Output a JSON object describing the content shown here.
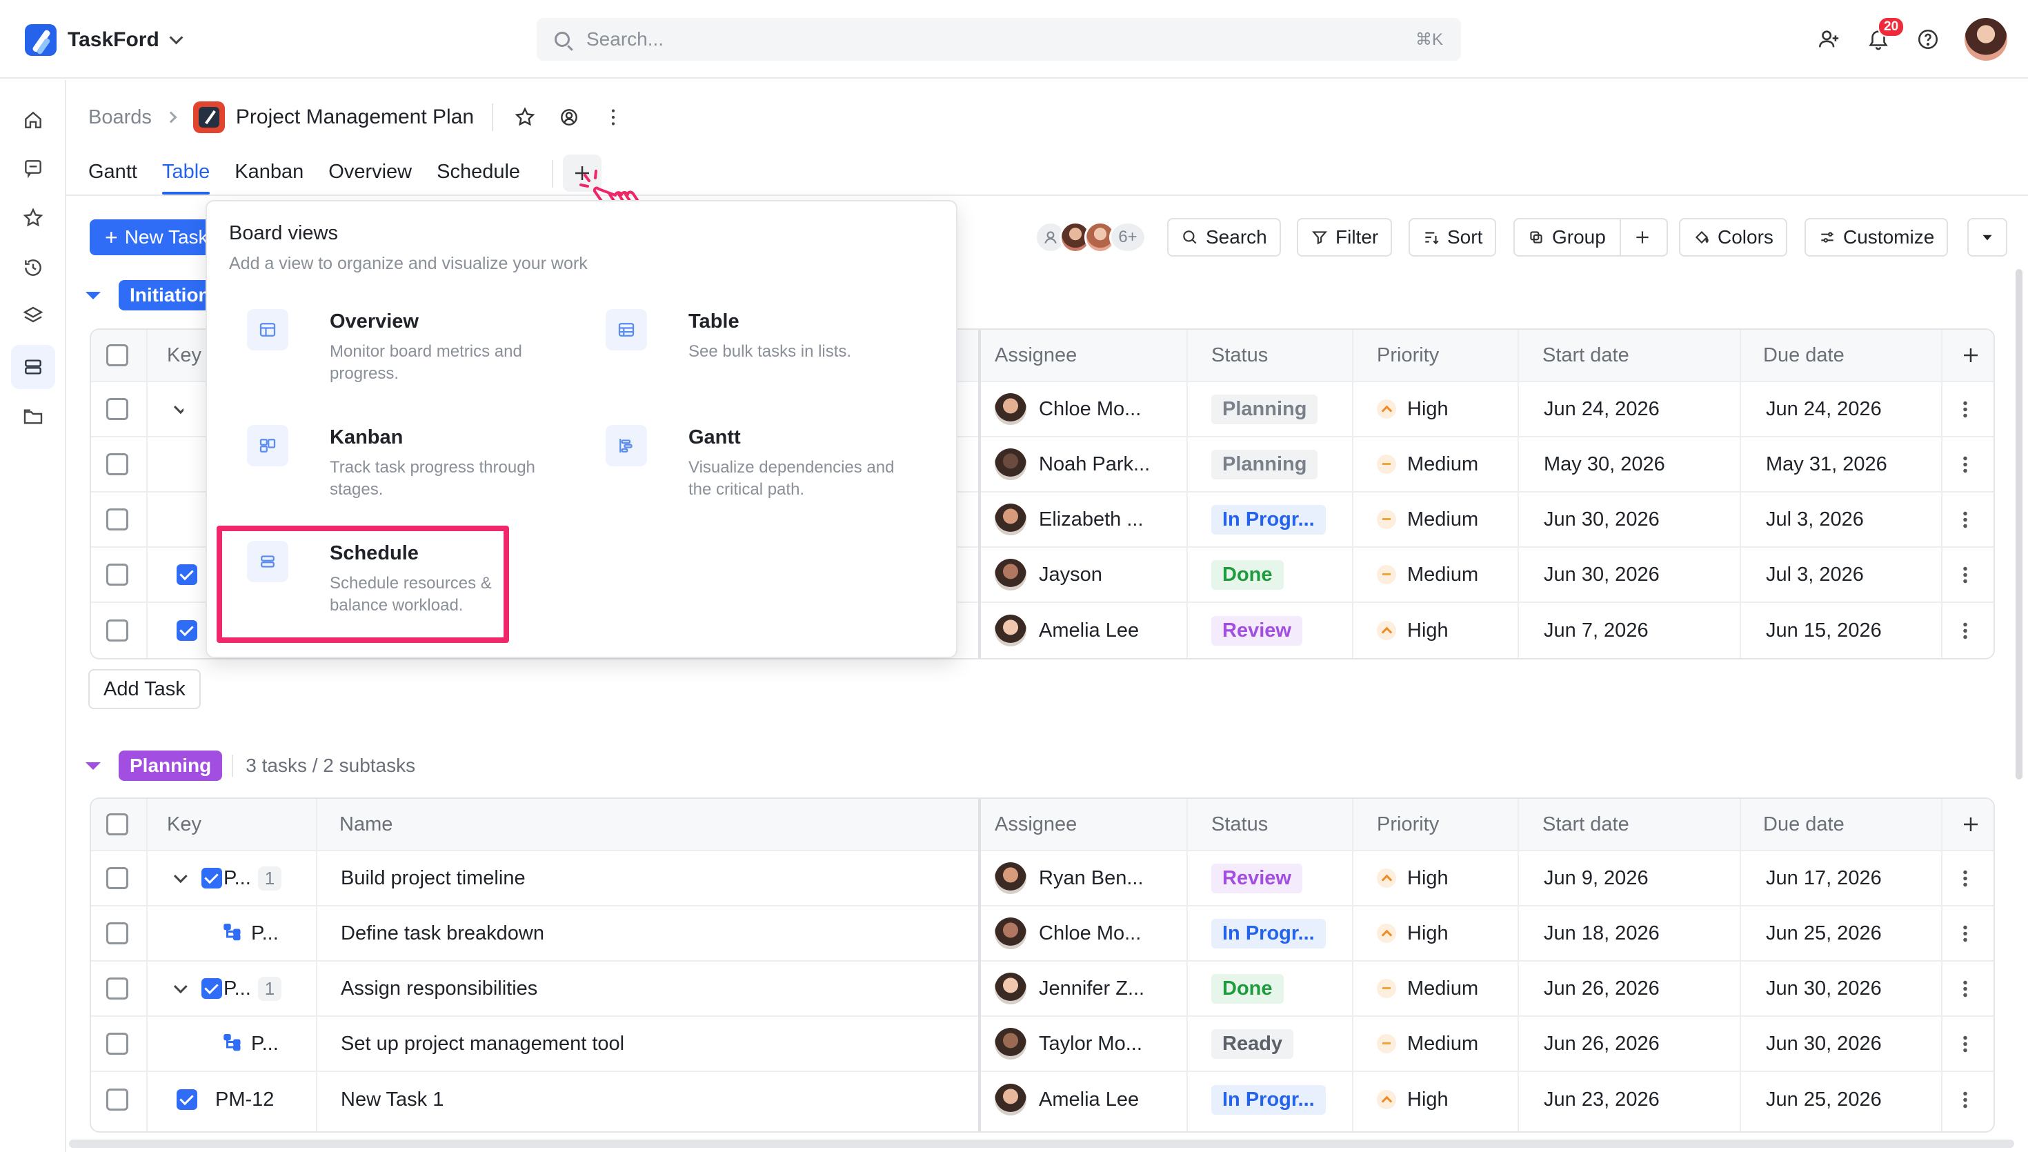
{
  "app": {
    "name": "TaskFord"
  },
  "search": {
    "placeholder": "Search...",
    "shortcut": "⌘K"
  },
  "notifications": {
    "count": "20"
  },
  "breadcrumb": {
    "root": "Boards",
    "board_title": "Project Management Plan"
  },
  "tabs": [
    {
      "label": "Gantt",
      "active": false
    },
    {
      "label": "Table",
      "active": true
    },
    {
      "label": "Kanban",
      "active": false
    },
    {
      "label": "Overview",
      "active": false
    },
    {
      "label": "Schedule",
      "active": false
    }
  ],
  "toolbar": {
    "new_task": "New Task",
    "members_more": "6+",
    "search": "Search",
    "filter": "Filter",
    "sort": "Sort",
    "group": "Group",
    "colors": "Colors",
    "customize": "Customize"
  },
  "columns": {
    "key": "Key",
    "name": "Name",
    "assignee": "Assignee",
    "status": "Status",
    "priority": "Priority",
    "start": "Start date",
    "due": "Due date"
  },
  "groups": {
    "initiation": {
      "label": "Initiation",
      "color": "#2f6df6",
      "rows": [
        {
          "assignee": "Chloe Mo...",
          "status": "Planning",
          "status_kind": "planning",
          "priority": "High",
          "start": "Jun 24, 2026",
          "due": "Jun 24, 2026"
        },
        {
          "assignee": "Noah Park...",
          "status": "Planning",
          "status_kind": "planning",
          "priority": "Medium",
          "start": "May 30, 2026",
          "due": "May 31, 2026"
        },
        {
          "assignee": "Elizabeth ...",
          "status": "In Progr...",
          "status_kind": "progress",
          "priority": "Medium",
          "start": "Jun 30, 2026",
          "due": "Jul 3, 2026"
        },
        {
          "assignee": "Jayson",
          "status": "Done",
          "status_kind": "done",
          "priority": "Medium",
          "start": "Jun 30, 2026",
          "due": "Jul 3, 2026"
        },
        {
          "assignee": "Amelia Lee",
          "status": "Review",
          "status_kind": "review",
          "priority": "High",
          "start": "Jun 7, 2026",
          "due": "Jun 15, 2026"
        }
      ],
      "add_task": "Add Task"
    },
    "planning": {
      "label": "Planning",
      "color": "#a24ee0",
      "count": "3 tasks / 2 subtasks",
      "rows": [
        {
          "key": "P...",
          "subcount": "1",
          "name": "Build project timeline",
          "assignee": "Ryan Ben...",
          "status": "Review",
          "status_kind": "review",
          "priority": "High",
          "start": "Jun 9, 2026",
          "due": "Jun 17, 2026"
        },
        {
          "key": "P...",
          "name": "Define task breakdown",
          "assignee": "Chloe Mo...",
          "status": "In Progr...",
          "status_kind": "progress",
          "priority": "High",
          "start": "Jun 18, 2026",
          "due": "Jun 25, 2026"
        },
        {
          "key": "P...",
          "subcount": "1",
          "name": "Assign responsibilities",
          "assignee": "Jennifer Z...",
          "status": "Done",
          "status_kind": "done",
          "priority": "Medium",
          "start": "Jun 26, 2026",
          "due": "Jun 30, 2026"
        },
        {
          "key": "P...",
          "name": "Set up project management tool",
          "assignee": "Taylor Mo...",
          "status": "Ready",
          "status_kind": "ready",
          "priority": "Medium",
          "start": "Jun 26, 2026",
          "due": "Jun 30, 2026"
        },
        {
          "key": "PM-12",
          "name": "New Task 1",
          "assignee": "Amelia Lee",
          "status": "In Progr...",
          "status_kind": "progress",
          "priority": "High",
          "start": "Jun 23, 2026",
          "due": "Jun 25, 2026"
        }
      ]
    }
  },
  "board_views": {
    "title": "Board views",
    "subtitle": "Add a view to organize and visualize your work",
    "options": [
      {
        "name": "Overview",
        "desc": "Monitor board metrics and progress.",
        "icon": "overview-icon"
      },
      {
        "name": "Table",
        "desc": "See bulk tasks in lists.",
        "icon": "table-icon"
      },
      {
        "name": "Kanban",
        "desc": "Track task progress through stages.",
        "icon": "kanban-icon"
      },
      {
        "name": "Gantt",
        "desc": "Visualize dependencies and the critical path.",
        "icon": "gantt-icon"
      },
      {
        "name": "Schedule",
        "desc": "Schedule resources & balance workload.",
        "icon": "schedule-icon"
      }
    ]
  },
  "colors": {
    "accent": "#2563eb",
    "highlight": "#f0286a",
    "initiation": "#2f6df6",
    "planning": "#a24ee0"
  }
}
